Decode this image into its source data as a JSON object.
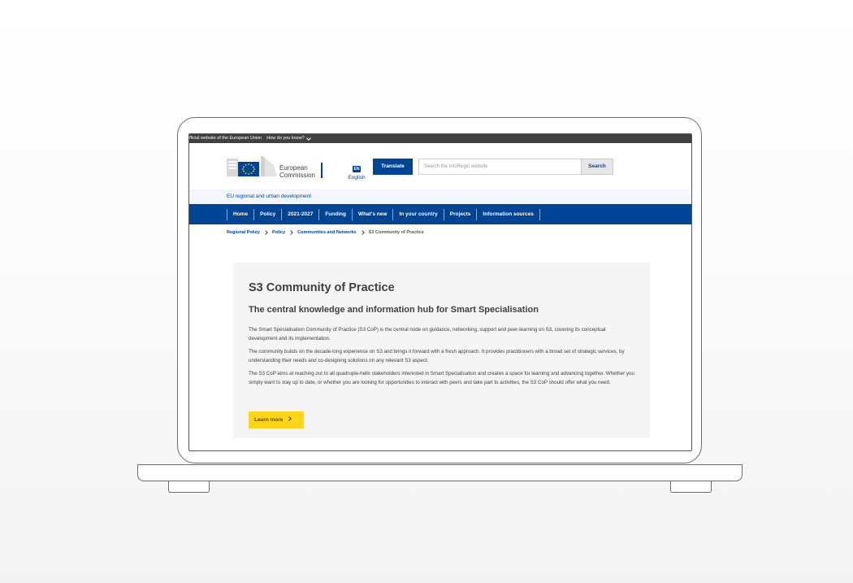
{
  "topbar": {
    "official_text": "official website of the European Union",
    "how_text": "How do you know?"
  },
  "header": {
    "logo_line1": "European",
    "logo_line2": "Commission",
    "lang_code": "EN",
    "lang_label": "English",
    "translate_label": "Translate",
    "search_placeholder": "Search the InfoRegio website",
    "search_label": "Search"
  },
  "site_name": "EU regional and urban development",
  "nav": {
    "items": [
      "Home",
      "Policy",
      "2021-2027",
      "Funding",
      "What's new",
      "In your country",
      "Projects",
      "Information sources"
    ]
  },
  "breadcrumb": {
    "items": [
      "Regional Policy",
      "Policy",
      "Communities and Networks",
      "S3 Community of Practice"
    ]
  },
  "content": {
    "title": "S3 Community of Practice",
    "subtitle": "The central knowledge and information hub for Smart Specialisation",
    "paragraphs": [
      "The Smart Specialisation Community of Practice (S3 CoP) is the central node on guidance, networking, support and peer-learning on S3, covering its conceptual development and its implementation.",
      "The community builds on the decade-long experience on S3 and brings it forward with a fresh approach. It provides practitioners with a broad set of strategic services, by understanding their needs and co-designing solutions on any relevant S3 aspect.",
      "The S3 CoP aims at reaching out to all quadruple-helix stakeholders interested in Smart Specialisation and creates a space for learning and advancing together. Whether you simply want to stay up to date, or whether you are looking for opportunities to interact with peers and take part to activities, the S3 CoP should offer what you need."
    ],
    "button_label": "Learn more"
  },
  "colors": {
    "ec_blue": "#004494",
    "topbar": "#404040",
    "accent_yellow": "#ffd617",
    "card_bg": "#f5f5f5"
  }
}
